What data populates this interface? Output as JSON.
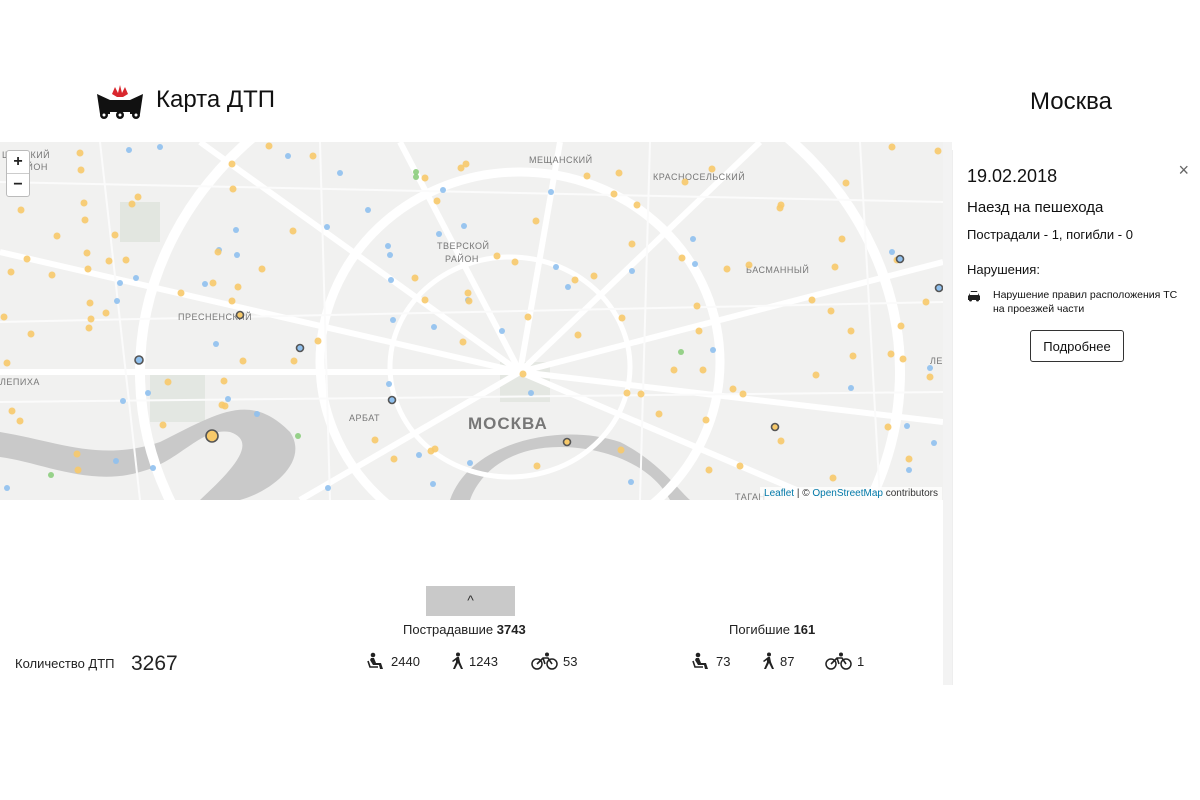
{
  "header": {
    "title": "Карта ДТП",
    "city": "Москва",
    "logo_icon": "crash-logo-icon"
  },
  "map": {
    "zoom_in": "+",
    "zoom_out": "−",
    "labels": {
      "shevsky": "ШЁВСКИЙ",
      "raion": "РАЙОН",
      "meshchansky": "МЕЩАНСКИЙ",
      "krasnoselsky": "КРАСНОСЕЛЬСКИЙ",
      "tverskoy": "ТВЕРСКОЙ",
      "tverskoy_raion": "РАЙОН",
      "basmanny": "БАСМАННЫЙ",
      "presnensky": "ПРЕСНЕНСКИЙ",
      "arbat": "АРБАТ",
      "moskva": "МОСКВА",
      "lepikha": "ЛЕПИХА",
      "tagan": "ТАГАН",
      "le": "ЛЕ"
    },
    "attribution": {
      "leaflet": "Leaflet",
      "separator": " | © ",
      "osm": "OpenStreetMap",
      "contributors": " contributors"
    },
    "colors": {
      "injured": "#f7c96a",
      "dead": "#8fc0ee",
      "green": "#8ccd7d",
      "selected_outline": "#555"
    }
  },
  "details": {
    "close": "×",
    "date": "19.02.2018",
    "type": "Наезд на пешехода",
    "casualties": "Пострадали - 1, погибли - 0",
    "violations_title": "Нарушения:",
    "violation": "Нарушение правил расположения ТС на проезжей части",
    "violation_icon": "car-icon",
    "more_button": "Подробнее"
  },
  "stats": {
    "collapse_icon": "^",
    "count_label": "Количество ДТП",
    "count_value": "3267",
    "injured": {
      "label": "Пострадавшие",
      "total": "3743",
      "drivers": "2440",
      "pedestrians": "1243",
      "cyclists": "53"
    },
    "dead": {
      "label": "Погибшие",
      "total": "161",
      "drivers": "73",
      "pedestrians": "87",
      "cyclists": "1"
    }
  }
}
